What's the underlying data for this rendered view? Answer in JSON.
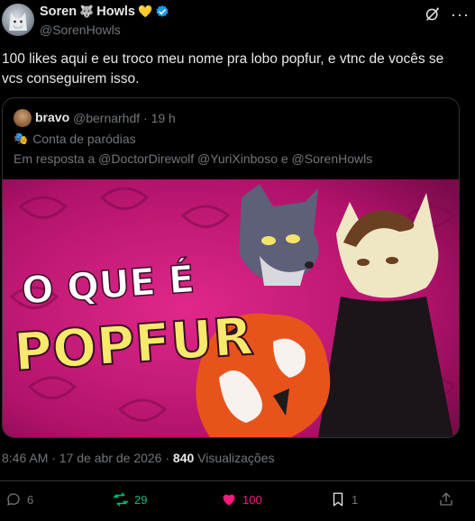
{
  "author": {
    "name": "Soren",
    "name_suffix": "Howls",
    "emoji_wolf": "🐺",
    "emoji_heart": "💛",
    "handle": "@SorenHowls"
  },
  "tweet": {
    "text": "100 likes aqui e eu troco meu nome pra lobo popfur, e vtnc de vocês se vcs conseguirem isso."
  },
  "quote": {
    "name": "bravo",
    "handle_time": "@bernarhdf · 19 h",
    "parody_emoji": "🎭",
    "parody_label": "Conta de paródias",
    "reply_to": "Em resposta a @DoctorDirewolf @YuriXinboso e @SorenHowls",
    "thumbnail": {
      "line1": "O QUE É",
      "line2": "POPFUR"
    }
  },
  "meta": {
    "time_date": "8:46 AM · 17 de abr de 2026 ·",
    "views_count": "840",
    "views_label": "Visualizações"
  },
  "actions": {
    "replies": "6",
    "reposts": "29",
    "likes": "100",
    "bookmarks": "1"
  },
  "colors": {
    "repost": "#00ba7c",
    "like": "#f91880",
    "verified": "#1d9bf0",
    "thumb_pink": "#d4157a",
    "thumb_yellow": "#f6e96b"
  }
}
